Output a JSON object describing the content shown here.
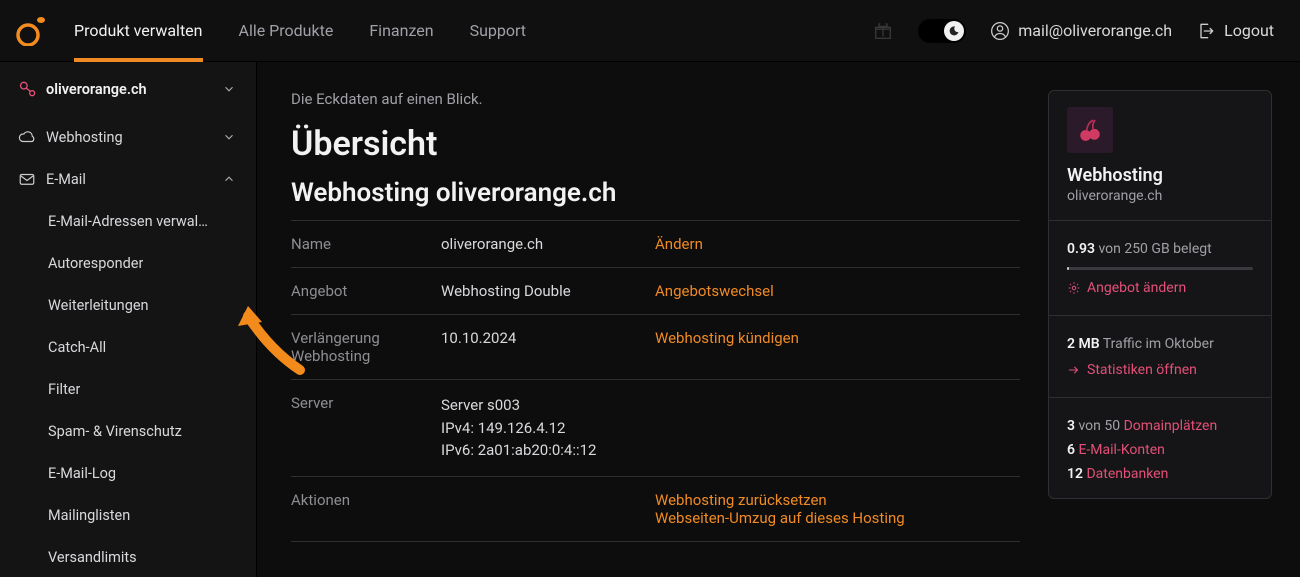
{
  "header": {
    "nav": {
      "manage": "Produkt verwalten",
      "all": "Alle Produkte",
      "finance": "Finanzen",
      "support": "Support"
    },
    "user_email": "mail@oliverorange.ch",
    "logout": "Logout"
  },
  "sidebar": {
    "domain": "oliverorange.ch",
    "webhosting": "Webhosting",
    "email": "E-Mail",
    "sub": {
      "addresses": "E-Mail-Adressen verwal…",
      "autoresponder": "Autoresponder",
      "forward": "Weiterleitungen",
      "catchall": "Catch-All",
      "filter": "Filter",
      "spam": "Spam- & Virenschutz",
      "log": "E-Mail-Log",
      "mailing": "Mailinglisten",
      "limits": "Versandlimits"
    }
  },
  "content": {
    "subtitle": "Die Eckdaten auf einen Blick.",
    "title": "Übersicht",
    "subject": "Webhosting oliverorange.ch",
    "rows": {
      "name_label": "Name",
      "name_value": "oliverorange.ch",
      "name_action": "Ändern",
      "offer_label": "Angebot",
      "offer_value": "Webhosting Double",
      "offer_action": "Angebotswechsel",
      "renewal_label": "Verlängerung Webhosting",
      "renewal_value": "10.10.2024",
      "renewal_action": "Webhosting kündigen",
      "server_label": "Server",
      "server_value_1": "Server s003",
      "server_value_2": "IPv4: 149.126.4.12",
      "server_value_3": "IPv6: 2a01:ab20:0:4::12",
      "actions_label": "Aktionen",
      "actions_1": "Webhosting zurücksetzen",
      "actions_2": "Webseiten-Umzug auf dieses Hosting"
    }
  },
  "card": {
    "title": "Webhosting",
    "domain": "oliverorange.ch",
    "storage_used": "0.93",
    "storage_text": " von 250 GB belegt",
    "change_offer": "Angebot ändern",
    "traffic_val": "2 MB",
    "traffic_text": " Traffic im Oktober",
    "stats": "Statistiken öffnen",
    "domains_num": "3",
    "domains_text": " von 50 ",
    "domains_label": "Domainplätzen",
    "emails_num": "6",
    "emails_label": " E-Mail-Konten",
    "db_num": "12",
    "db_label": " Datenbanken"
  }
}
